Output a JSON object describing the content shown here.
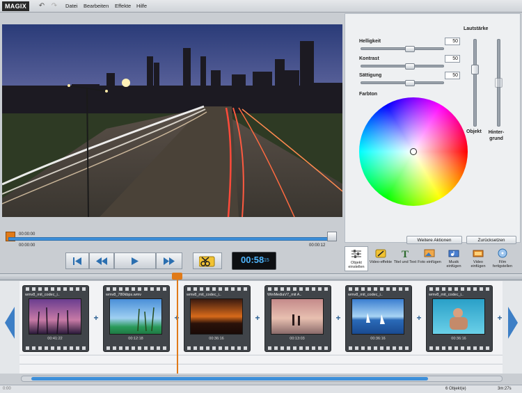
{
  "app": {
    "logo": "MAGIX"
  },
  "menu": [
    "Datei",
    "Bearbeiten",
    "Effekte",
    "Hilfe"
  ],
  "scrub": {
    "top_left_time": "00:00:00",
    "bottom_left_time": "00:00:00",
    "bottom_right_time": "00:00:12"
  },
  "timecode": {
    "main": "00:58",
    "frames": "15"
  },
  "panel": {
    "brightness_label": "Helligkeit",
    "brightness_value": "50",
    "contrast_label": "Kontrast",
    "contrast_value": "50",
    "saturation_label": "Sättigung",
    "saturation_value": "50",
    "hue_label": "Farbton",
    "volume_label": "Lautstärke",
    "object_label": "Objekt",
    "background_label": "Hinter-\ngrund",
    "more_actions": "Weitere Aktionen",
    "reset": "Zurücksetzen"
  },
  "tools": [
    {
      "label": "Objekt einstellen",
      "icon": "sliders-icon"
    },
    {
      "label": "Video-effekte",
      "icon": "magic-wand-icon"
    },
    {
      "label": "Titel und Text",
      "icon": "text-icon"
    },
    {
      "label": "Foto einfügen",
      "icon": "photo-icon"
    },
    {
      "label": "Musik einfügen",
      "icon": "music-icon"
    },
    {
      "label": "Video einfügen",
      "icon": "video-icon"
    },
    {
      "label": "Film fertigstellen",
      "icon": "disc-icon"
    }
  ],
  "clips": [
    {
      "name": "wmv8_mit_codec_i..",
      "duration": "00:41:22"
    },
    {
      "name": "wmv8_780kbps.wmv",
      "duration": "00:12:18"
    },
    {
      "name": "wmv8_mit_codec_i..",
      "duration": "00:36:16"
    },
    {
      "name": "WinMediaV7_mit A..",
      "duration": "00:13:03"
    },
    {
      "name": "wmv8_mit_codec_i..",
      "duration": "00:36:16"
    },
    {
      "name": "wmv8_mit_codec_i..",
      "duration": "00:36:16"
    }
  ],
  "status": {
    "left": "0:00",
    "objects": "6 Objekt(e)",
    "total": "3m:27s"
  },
  "colors": {
    "accent": "#3d8fd9",
    "playhead": "#e07a18",
    "timecode": "#4fb6ff"
  }
}
